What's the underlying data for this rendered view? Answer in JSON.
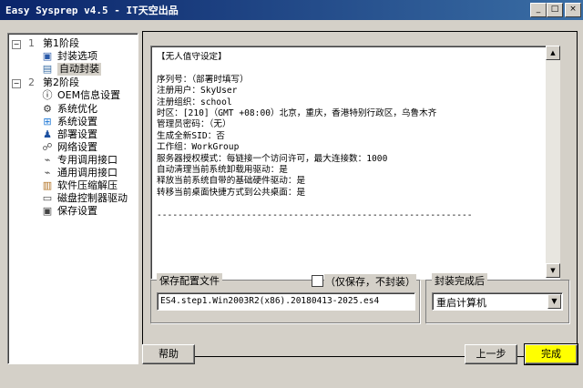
{
  "window": {
    "title": "Easy Sysprep v4.5 - IT天空出品"
  },
  "sidebar": {
    "phases": [
      {
        "label": "第1阶段",
        "expander": "−",
        "number": "1",
        "items": [
          {
            "label": "封装选项",
            "icon": "monitor-icon"
          },
          {
            "label": "自动封装",
            "icon": "computer-icon",
            "selected": true
          }
        ]
      },
      {
        "label": "第2阶段",
        "expander": "−",
        "number": "2",
        "items": [
          {
            "label": "OEM信息设置",
            "icon": "info-icon"
          },
          {
            "label": "系统优化",
            "icon": "gear-icon"
          },
          {
            "label": "系统设置",
            "icon": "windows-icon"
          },
          {
            "label": "部署设置",
            "icon": "users-icon"
          },
          {
            "label": "网络设置",
            "icon": "network-icon"
          },
          {
            "label": "专用调用接口",
            "icon": "plugin-icon"
          },
          {
            "label": "通用调用接口",
            "icon": "plugin-icon"
          },
          {
            "label": "软件压缩解压",
            "icon": "archive-icon"
          },
          {
            "label": "磁盘控制器驱动",
            "icon": "disk-icon"
          },
          {
            "label": "保存设置",
            "icon": "save-icon"
          }
        ]
      }
    ]
  },
  "main": {
    "info_text": "【无人值守设定】\n\n序列号：（部署时填写）\n注册用户：SkyUser\n注册组织：school\n时区：[210]（GMT +08:00）北京，重庆，香港特别行政区，乌鲁木齐\n管理员密码：（无）\n生成全新SID：否\n工作组：WorkGroup\n服务器授权模式：每链接一个访问许可，最大连接数：1000\n自动清理当前系统卸载用驱动：是\n释放当前系统自带的基础硬件驱动：是\n转移当前桌面快捷方式到公共桌面：是\n\n------------------------------------------------------------"
  },
  "save_config": {
    "group_title": "保存配置文件",
    "checkbox_label": "（仅保存，不封装）",
    "checkbox_checked": false,
    "filename": "ES4.step1.Win2003R2(x86).20180413-2025.es4"
  },
  "after_complete": {
    "group_title": "封装完成后",
    "selected": "重启计算机"
  },
  "buttons": {
    "help": "帮助",
    "prev": "上一步",
    "finish": "完成"
  },
  "colors": {
    "titlebar": "#0a246a",
    "finish_button": "#ffff00"
  }
}
